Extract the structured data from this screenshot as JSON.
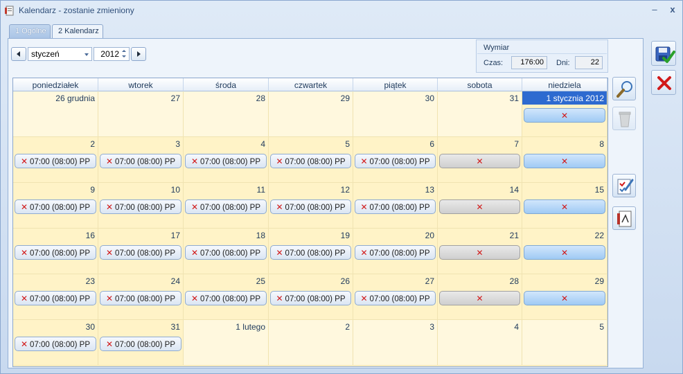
{
  "window": {
    "title": "Kalendarz - zostanie zmieniony",
    "minimize": "–",
    "close": "x"
  },
  "tabs": [
    {
      "label": "1 Ogólne"
    },
    {
      "label": "2 Kalendarz"
    }
  ],
  "nav": {
    "month": "styczeń",
    "year": "2012"
  },
  "wymiar": {
    "title": "Wymiar",
    "czas_label": "Czas:",
    "czas_value": "176:00",
    "dni_label": "Dni:",
    "dni_value": "22"
  },
  "calendar": {
    "weekdays": [
      "poniedziałek",
      "wtorek",
      "środa",
      "czwartek",
      "piątek",
      "sobota",
      "niedziela"
    ],
    "work_label": "07:00 (08:00) PP",
    "weeks": [
      [
        "26 grudnia",
        "27",
        "28",
        "29",
        "30",
        "31",
        "1 stycznia 2012"
      ],
      [
        "2",
        "3",
        "4",
        "5",
        "6",
        "7",
        "8"
      ],
      [
        "9",
        "10",
        "11",
        "12",
        "13",
        "14",
        "15"
      ],
      [
        "16",
        "17",
        "18",
        "19",
        "20",
        "21",
        "22"
      ],
      [
        "23",
        "24",
        "25",
        "26",
        "27",
        "28",
        "29"
      ],
      [
        "30",
        "31",
        "1 lutego",
        "2",
        "3",
        "4",
        "5"
      ]
    ],
    "colors": {
      "work": "#dbe6f3",
      "saturday": "#cfcfcf",
      "sunday": "#9fcaf4",
      "today": "#2d6ad0",
      "cell": "#fff3c7"
    }
  }
}
